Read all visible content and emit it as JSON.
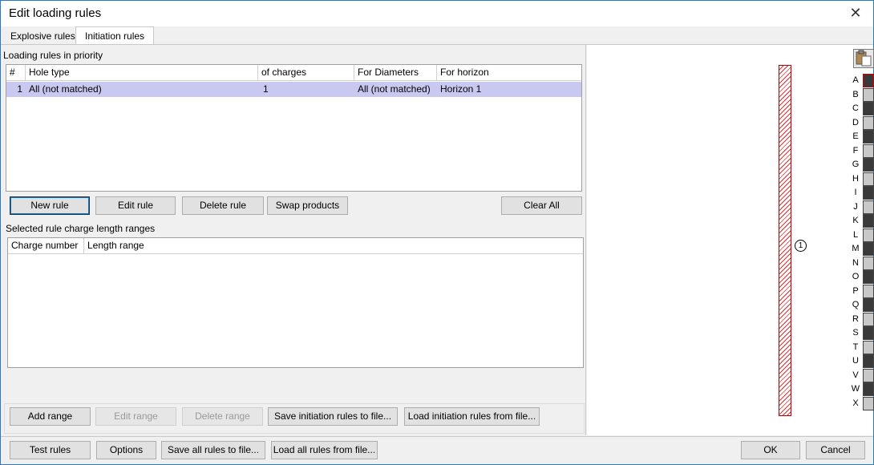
{
  "window": {
    "title": "Edit loading rules"
  },
  "tabs": {
    "explosive": "Explosive rules",
    "initiation": "Initiation rules"
  },
  "rules": {
    "label": "Loading rules in priority",
    "columns": [
      "#",
      "Hole type",
      "of charges",
      "For Diameters",
      "For horizon"
    ],
    "rows": [
      {
        "num": "1",
        "hole_type": "All (not matched)",
        "charges": "1",
        "diameters": "All (not matched)",
        "horizon": "Horizon 1"
      }
    ]
  },
  "rule_buttons": {
    "new": "New rule",
    "edit": "Edit rule",
    "delete": "Delete rule",
    "swap": "Swap products",
    "clear": "Clear All"
  },
  "ranges": {
    "label": "Selected rule charge length ranges",
    "columns": [
      "Charge number",
      "Length range"
    ]
  },
  "range_buttons": {
    "add": "Add range",
    "edit": "Edit range",
    "delete": "Delete range",
    "save": "Save initiation rules to file...",
    "load": "Load initiation rules from file..."
  },
  "bottom_buttons": {
    "test": "Test rules",
    "options": "Options",
    "save_all": "Save all rules to file...",
    "load_all": "Load all rules from file...",
    "ok": "OK",
    "cancel": "Cancel"
  },
  "preview": {
    "charge_marker": "1",
    "letters": [
      "A",
      "B",
      "C",
      "D",
      "E",
      "F",
      "G",
      "H",
      "I",
      "J",
      "K",
      "L",
      "M",
      "N",
      "O",
      "P",
      "Q",
      "R",
      "S",
      "T",
      "U",
      "V",
      "W",
      "X"
    ],
    "swatch_colors": [
      "#3a3a3a",
      "#c8c8c8"
    ],
    "hatch_color": "#e03030"
  }
}
